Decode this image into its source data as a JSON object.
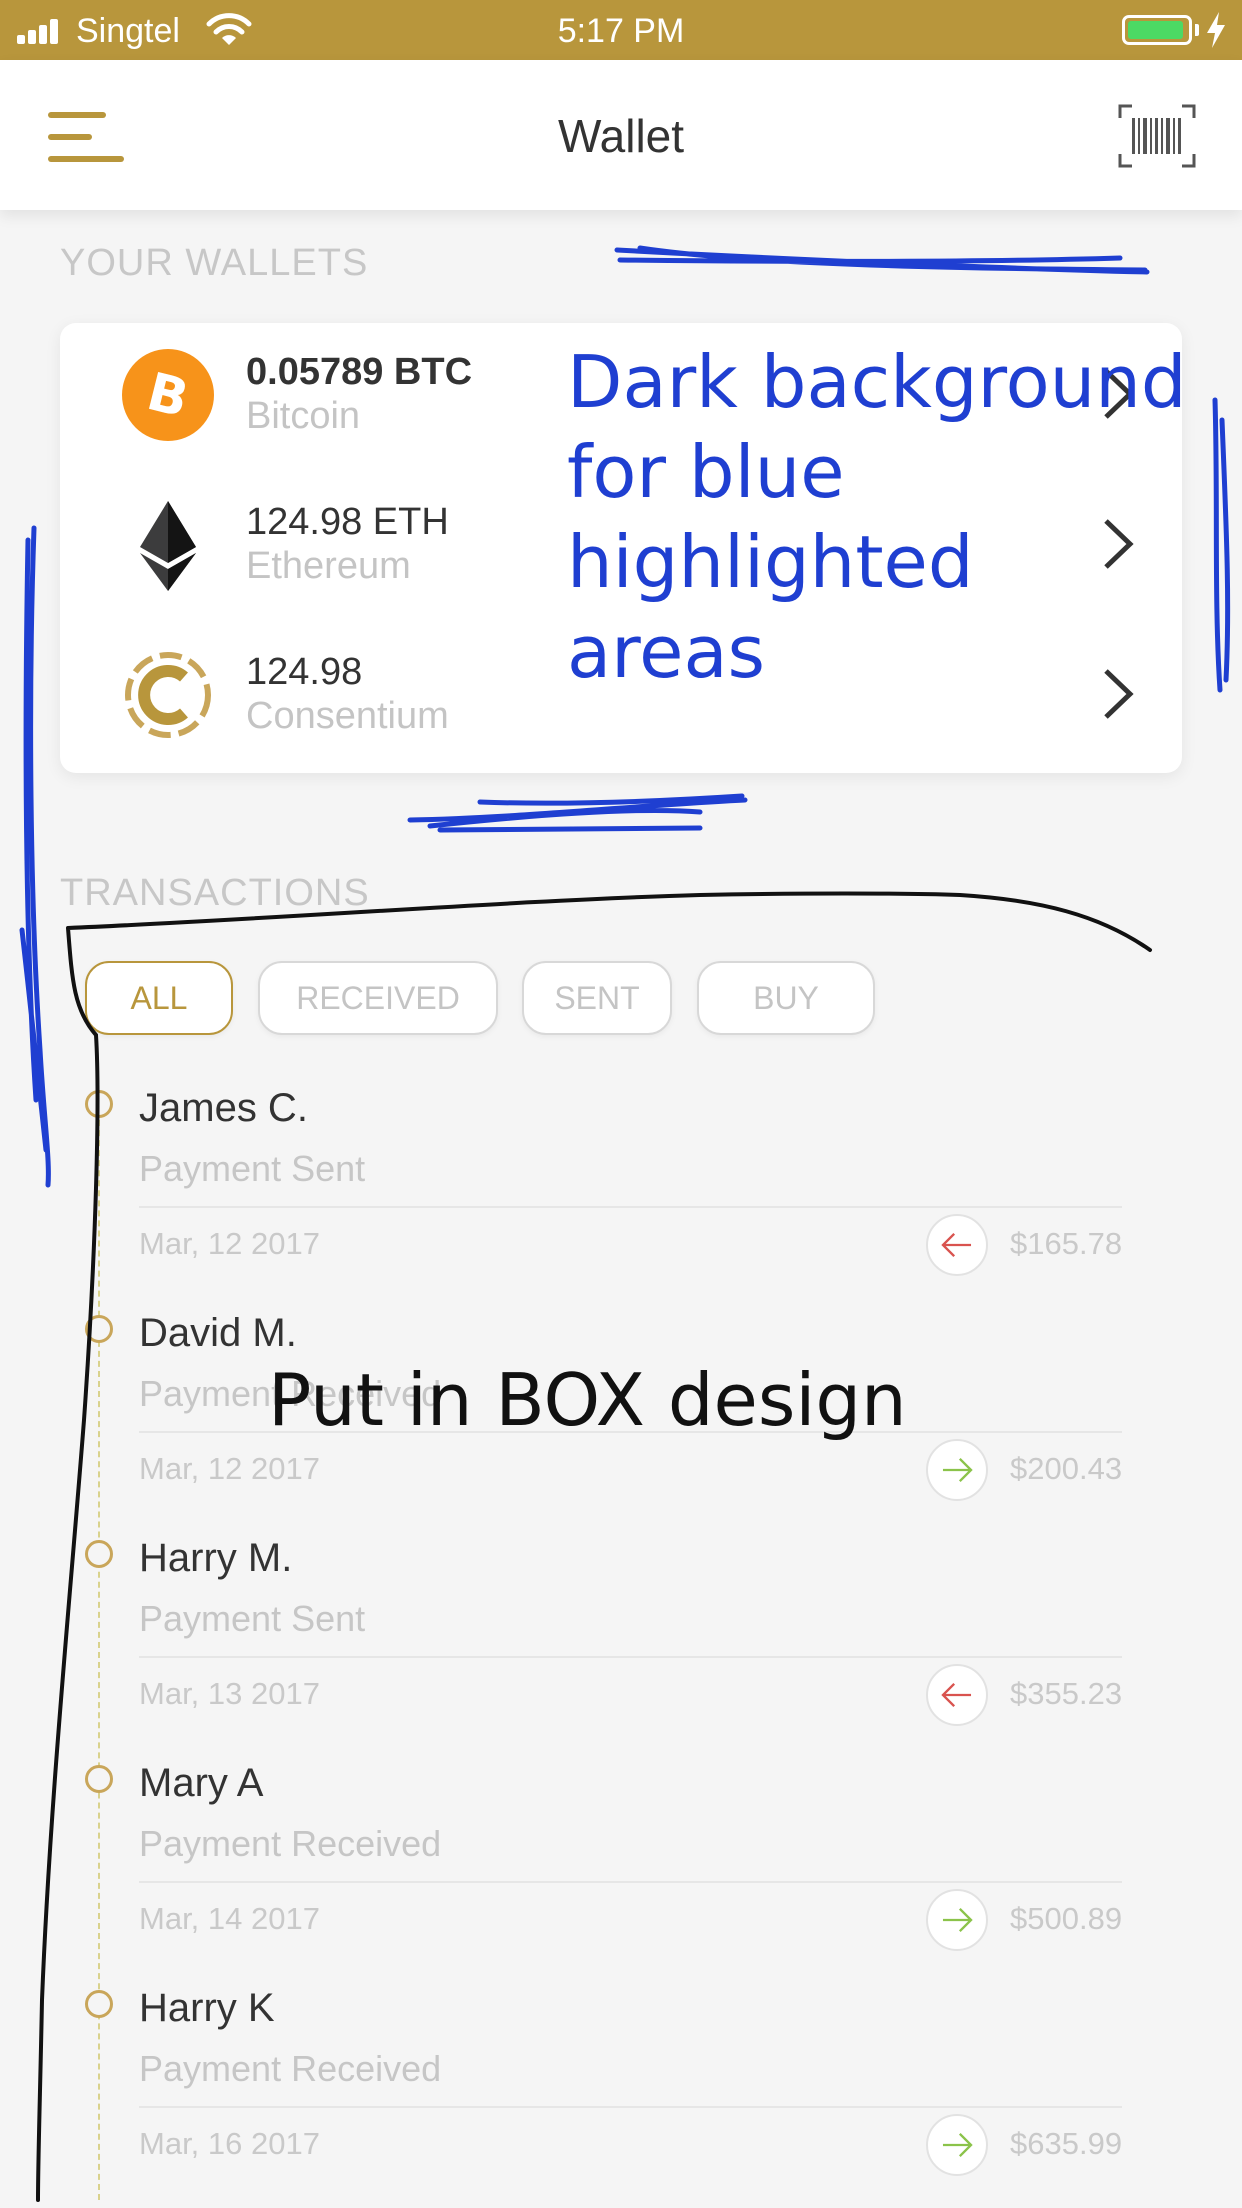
{
  "status_bar": {
    "carrier": "Singtel",
    "time": "5:17 PM",
    "battery_level": 0.95
  },
  "nav": {
    "title": "Wallet"
  },
  "wallets": {
    "section_title": "YOUR WALLETS",
    "items": [
      {
        "amount": "0.05789 BTC",
        "name": "Bitcoin",
        "icon": "bitcoin-icon"
      },
      {
        "amount": "124.98 ETH",
        "name": "Ethereum",
        "icon": "ethereum-icon"
      },
      {
        "amount": "124.98",
        "name": "Consentium",
        "icon": "consentium-icon"
      }
    ]
  },
  "transactions": {
    "section_title": "TRANSACTIONS",
    "filters": [
      {
        "label": "ALL",
        "active": true
      },
      {
        "label": "RECEIVED",
        "active": false
      },
      {
        "label": "SENT",
        "active": false
      },
      {
        "label": "BUY",
        "active": false
      }
    ],
    "items": [
      {
        "name": "James C.",
        "type": "Payment Sent",
        "date": "Mar, 12 2017",
        "amount": "$165.78",
        "direction": "sent"
      },
      {
        "name": "David M.",
        "type": "Payment Received",
        "date": "Mar, 12 2017",
        "amount": "$200.43",
        "direction": "received"
      },
      {
        "name": "Harry M.",
        "type": "Payment Sent",
        "date": "Mar, 13 2017",
        "amount": "$355.23",
        "direction": "sent"
      },
      {
        "name": "Mary A",
        "type": "Payment Received",
        "date": "Mar, 14 2017",
        "amount": "$500.89",
        "direction": "received"
      },
      {
        "name": "Harry K",
        "type": "Payment Received",
        "date": "Mar, 16 2017",
        "amount": "$635.99",
        "direction": "received"
      }
    ]
  },
  "annotations": {
    "blue_note": "Dark background\nfor blue\nhighlighted\nareas",
    "black_note": "Put in BOX design"
  },
  "colors": {
    "accent_gold": "#b8963c",
    "annotation_blue": "#1f3fd1",
    "sent_red": "#d9534f",
    "received_green": "#8bc34a"
  }
}
